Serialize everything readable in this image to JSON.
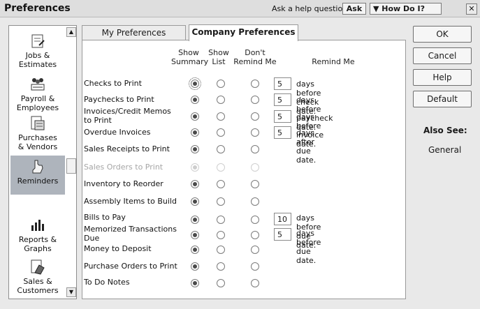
{
  "window": {
    "title": "Preferences",
    "help_label": "Ask a help question",
    "ask_label": "Ask",
    "howdoi_label": "▼ How Do I?",
    "close_glyph": "✕"
  },
  "sidebar": {
    "items": [
      {
        "label": "Jobs &\nEstimates",
        "icon": "jobs-estimates-icon"
      },
      {
        "label": "Payroll &\nEmployees",
        "icon": "payroll-icon"
      },
      {
        "label": "Purchases\n& Vendors",
        "icon": "purchases-icon"
      },
      {
        "label": "Reminders",
        "icon": "reminders-icon",
        "selected": true
      },
      {
        "label": "Reports &\nGraphs",
        "icon": "reports-graphs-icon"
      },
      {
        "label": "Sales &\nCustomers",
        "icon": "sales-customers-icon"
      }
    ]
  },
  "tabs": {
    "my": "My Preferences",
    "company": "Company Preferences"
  },
  "columns": {
    "show_summary": "Show\nSummary",
    "show_list": "Show\nList",
    "dont_remind": "Don't\nRemind Me",
    "remind_me": "Remind Me"
  },
  "reminders": [
    {
      "label": "Checks to Print",
      "selected": "summary",
      "days": "5",
      "suffix": "days before check date."
    },
    {
      "label": "Paychecks to Print",
      "selected": "summary",
      "days": "5",
      "suffix": "days before paycheck date."
    },
    {
      "label": "Invoices/Credit Memos\nto Print",
      "selected": "summary",
      "days": "5",
      "suffix": "days before invoice date."
    },
    {
      "label": "Overdue Invoices",
      "selected": "summary",
      "days": "5",
      "suffix": "days after due date."
    },
    {
      "label": "Sales Receipts to Print",
      "selected": "summary"
    },
    {
      "label": "Sales Orders to Print",
      "selected": "summary",
      "disabled": true
    },
    {
      "label": "Inventory to Reorder",
      "selected": "summary"
    },
    {
      "label": "Assembly Items to Build",
      "selected": "summary"
    },
    {
      "label": "Bills to Pay",
      "selected": "summary",
      "days": "10",
      "suffix": "days before due date."
    },
    {
      "label": "Memorized Transactions\nDue",
      "selected": "summary",
      "days": "5",
      "suffix": "days before due date."
    },
    {
      "label": "Money to Deposit",
      "selected": "summary"
    },
    {
      "label": "Purchase Orders to Print",
      "selected": "summary"
    },
    {
      "label": "To Do Notes",
      "selected": "summary"
    }
  ],
  "buttons": {
    "ok": "OK",
    "cancel": "Cancel",
    "help": "Help",
    "default": "Default"
  },
  "also_see": {
    "heading": "Also See:",
    "link": "General"
  }
}
